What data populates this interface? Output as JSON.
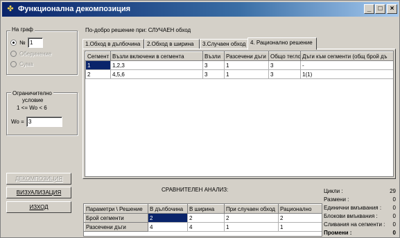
{
  "window": {
    "title": "Функционална декомпозиция",
    "buttons": {
      "minimize": "_",
      "maximize": "□",
      "close": "×"
    }
  },
  "graph_group": {
    "label": "На граф",
    "options": [
      {
        "label": "№",
        "checked": true,
        "enabled": true
      },
      {
        "label": "Обединение",
        "checked": false,
        "enabled": false
      },
      {
        "label": "Сума",
        "checked": false,
        "enabled": false
      }
    ],
    "number_value": "1"
  },
  "constraint_group": {
    "label_lines": [
      "Ограничително",
      "условие",
      "1 <= Wo < 6"
    ],
    "wo_label": "Wo =",
    "wo_value": "3"
  },
  "buttons": {
    "decomposition": "ДЕКОМПОЗИЦИЯ",
    "visualization": "ВИЗУАЛИЗАЦИЯ",
    "exit": "ИЗХОД"
  },
  "best_solution": "По-добро решение при: СЛУЧАЕН обход",
  "tabs": [
    {
      "label": "1.Обход в дълбочина",
      "active": false
    },
    {
      "label": "2.Обход в ширина",
      "active": false
    },
    {
      "label": "3.Случаен обход",
      "active": false
    },
    {
      "label": "4. Рационално решение",
      "active": true
    }
  ],
  "segments_table": {
    "columns": [
      "Сегмент №",
      "Възли включени в сегмента",
      "Възли",
      "Разсечени дъги",
      "Общо тегло",
      "Дъги към сегменти (общ брой дъ"
    ],
    "rows": [
      [
        "1",
        "1,2,3",
        "3",
        "1",
        "3",
        "-"
      ],
      [
        "2",
        "4,5,6",
        "3",
        "1",
        "3",
        "1(1)"
      ]
    ]
  },
  "comparison": {
    "title": "СРАВНИТЕЛЕН АНАЛИЗ:",
    "columns": [
      "Параметри \\ Решение",
      "В дълбочина",
      "В ширина",
      "При случаен обход",
      "Рационално"
    ],
    "rows": [
      [
        "Брой сегменти",
        "2",
        "2",
        "2",
        "2"
      ],
      [
        "Разсечени дъги",
        "4",
        "4",
        "1",
        "1"
      ]
    ]
  },
  "stats": [
    {
      "label": "Цикли :",
      "value": "29",
      "bold": false
    },
    {
      "label": "Размени :",
      "value": "0",
      "bold": false
    },
    {
      "label": "Единични вмъквания :",
      "value": "0",
      "bold": false
    },
    {
      "label": "Блокови вмъквания :",
      "value": "0",
      "bold": false
    },
    {
      "label": "Сливания на сегменти :",
      "value": "0",
      "bold": false
    },
    {
      "label": "Промени :",
      "value": "0",
      "bold": true
    }
  ]
}
